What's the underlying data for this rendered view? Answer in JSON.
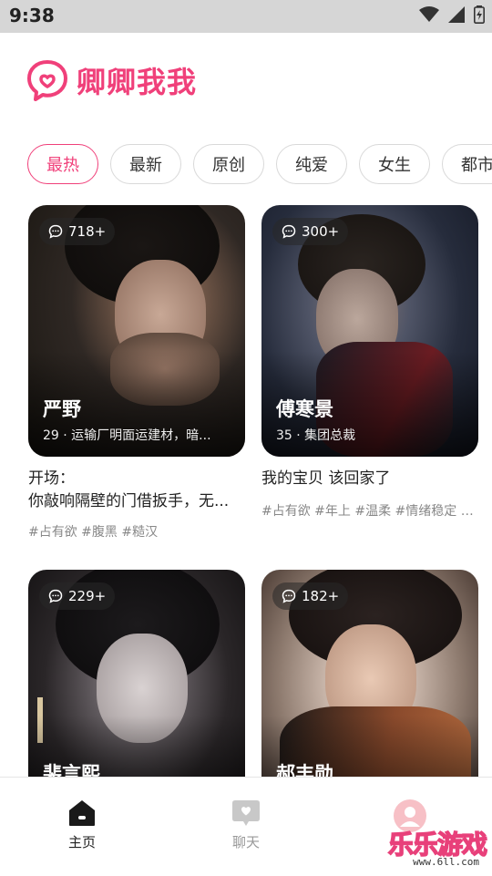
{
  "status": {
    "time": "9:38"
  },
  "app": {
    "title": "卿卿我我",
    "accent": "#f0407a"
  },
  "tabs": [
    {
      "label": "最热",
      "active": true
    },
    {
      "label": "最新"
    },
    {
      "label": "原创"
    },
    {
      "label": "纯爱"
    },
    {
      "label": "女生"
    },
    {
      "label": "都市"
    }
  ],
  "cards": [
    {
      "count": "718+",
      "name": "严野",
      "subtitle": "29 · 运输厂明面运建材，暗...",
      "text_line1": "开场：",
      "text_line2": "你敲响隔壁的门借扳手，无...",
      "tags": "#占有欲 #腹黑 #糙汉"
    },
    {
      "count": "300+",
      "name": "傅寒景",
      "subtitle": "35 · 集团总裁",
      "text_line1": "我的宝贝 该回家了",
      "tags": "#占有欲 #年上 #温柔 #情绪稳定 #..."
    },
    {
      "count": "229+",
      "name": "裴言熙"
    },
    {
      "count": "182+",
      "name": "郝丰勋"
    }
  ],
  "nav": {
    "home": "主页",
    "chat": "聊天"
  },
  "watermark": {
    "text": "乐乐游戏",
    "url": "www.6ll.com"
  }
}
